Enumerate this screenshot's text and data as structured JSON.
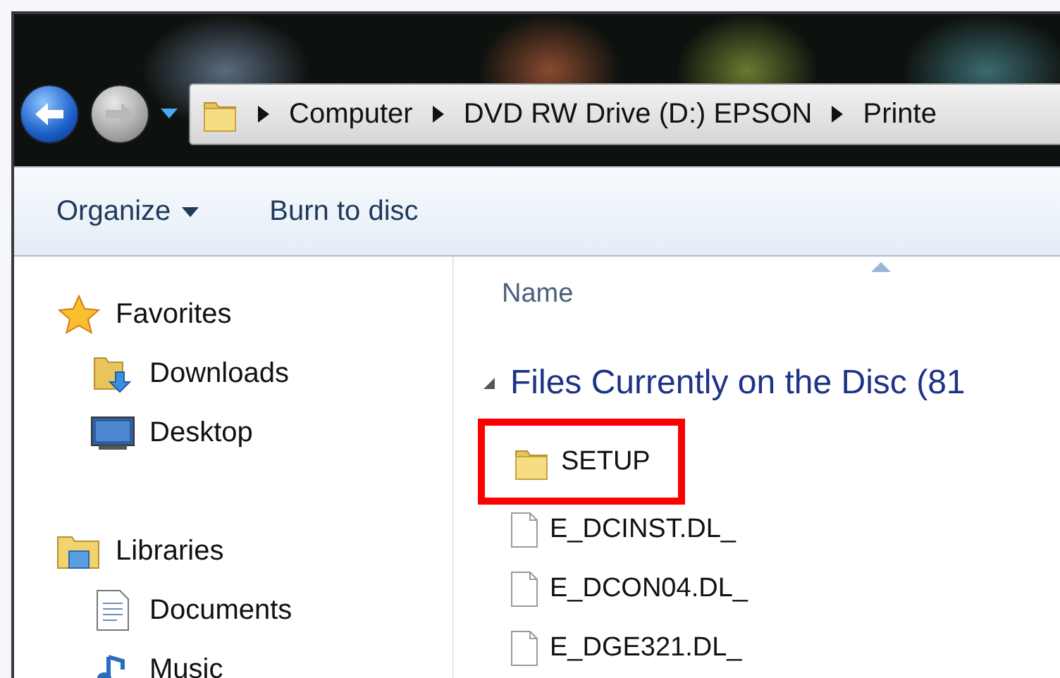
{
  "address_bar": {
    "crumbs": [
      "Computer",
      "DVD RW Drive (D:) EPSON",
      "Printe"
    ]
  },
  "toolbar": {
    "buttons": [
      {
        "label": "Organize",
        "kind": "menu"
      },
      {
        "label": "Burn to disc",
        "kind": "plain"
      }
    ]
  },
  "navigation_pane": {
    "groups": [
      {
        "label": "Favorites",
        "kind": "favorites",
        "children": [
          {
            "label": "Downloads",
            "kind": "downloads"
          },
          {
            "label": "Desktop",
            "kind": "desktop"
          }
        ]
      },
      {
        "label": "Libraries",
        "kind": "libraries",
        "children": [
          {
            "label": "Documents",
            "kind": "documents"
          },
          {
            "label": "Music",
            "kind": "music"
          }
        ]
      }
    ]
  },
  "file_list": {
    "column": "Name",
    "group": {
      "label": "Files Currently on the Disc (81",
      "expanded": true
    },
    "items": [
      {
        "name": "SETUP",
        "kind": "folder",
        "highlighted": true
      },
      {
        "name": "E_DCINST.DL_",
        "kind": "file",
        "highlighted": false
      },
      {
        "name": "E_DCON04.DL_",
        "kind": "file",
        "highlighted": false
      },
      {
        "name": "E_DGE321.DL_",
        "kind": "file",
        "highlighted": false
      }
    ]
  }
}
